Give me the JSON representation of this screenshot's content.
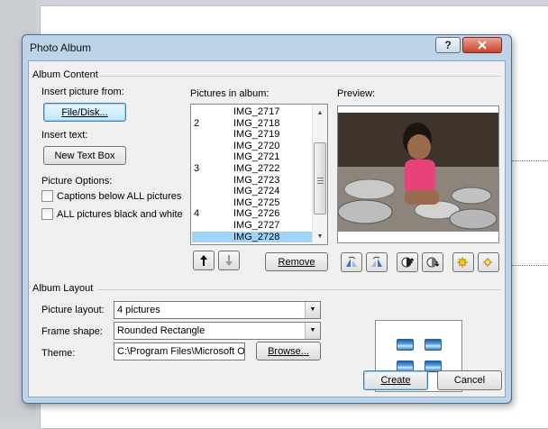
{
  "dialog": {
    "title": "Photo Album",
    "help_label": "?",
    "close_label": "x"
  },
  "album_content": {
    "group_label": "Album Content",
    "insert_picture_label": "Insert picture from:",
    "file_disk_button": "File/Disk...",
    "insert_text_label": "Insert text:",
    "new_text_box_button": "New Text Box",
    "picture_options_label": "Picture Options:",
    "captions_checkbox": {
      "label": "Captions below ALL pictures",
      "checked": false
    },
    "bw_checkbox": {
      "label": "ALL pictures black and white",
      "checked": false
    },
    "pictures_in_album_label": "Pictures in album:",
    "pictures": [
      {
        "num": "",
        "name": "IMG_2717"
      },
      {
        "num": "2",
        "name": "IMG_2718"
      },
      {
        "num": "",
        "name": "IMG_2719"
      },
      {
        "num": "",
        "name": "IMG_2720"
      },
      {
        "num": "",
        "name": "IMG_2721"
      },
      {
        "num": "3",
        "name": "IMG_2722"
      },
      {
        "num": "",
        "name": "IMG_2723"
      },
      {
        "num": "",
        "name": "IMG_2724"
      },
      {
        "num": "",
        "name": "IMG_2725"
      },
      {
        "num": "4",
        "name": "IMG_2726"
      },
      {
        "num": "",
        "name": "IMG_2727"
      },
      {
        "num": "",
        "name": "IMG_2728",
        "selected": true
      }
    ],
    "move_up_icon": "arrow-up-icon",
    "move_down_icon": "arrow-down-icon",
    "remove_button": "Remove",
    "preview_label": "Preview:",
    "preview_tools": [
      "rotate-left-icon",
      "rotate-right-icon",
      "contrast-up-icon",
      "contrast-down-icon",
      "brightness-up-icon",
      "brightness-down-icon"
    ]
  },
  "album_layout": {
    "group_label": "Album Layout",
    "picture_layout_label": "Picture layout:",
    "picture_layout_value": "4 pictures",
    "frame_shape_label": "Frame shape:",
    "frame_shape_value": "Rounded Rectangle",
    "theme_label": "Theme:",
    "theme_value": "C:\\Program Files\\Microsoft Of",
    "browse_button": "Browse..."
  },
  "buttons": {
    "create": "Create",
    "cancel": "Cancel"
  },
  "colors": {
    "dialog_frame": "#bcd3ea",
    "selection": "#9fd3f7",
    "close_button": "#c8432a"
  }
}
